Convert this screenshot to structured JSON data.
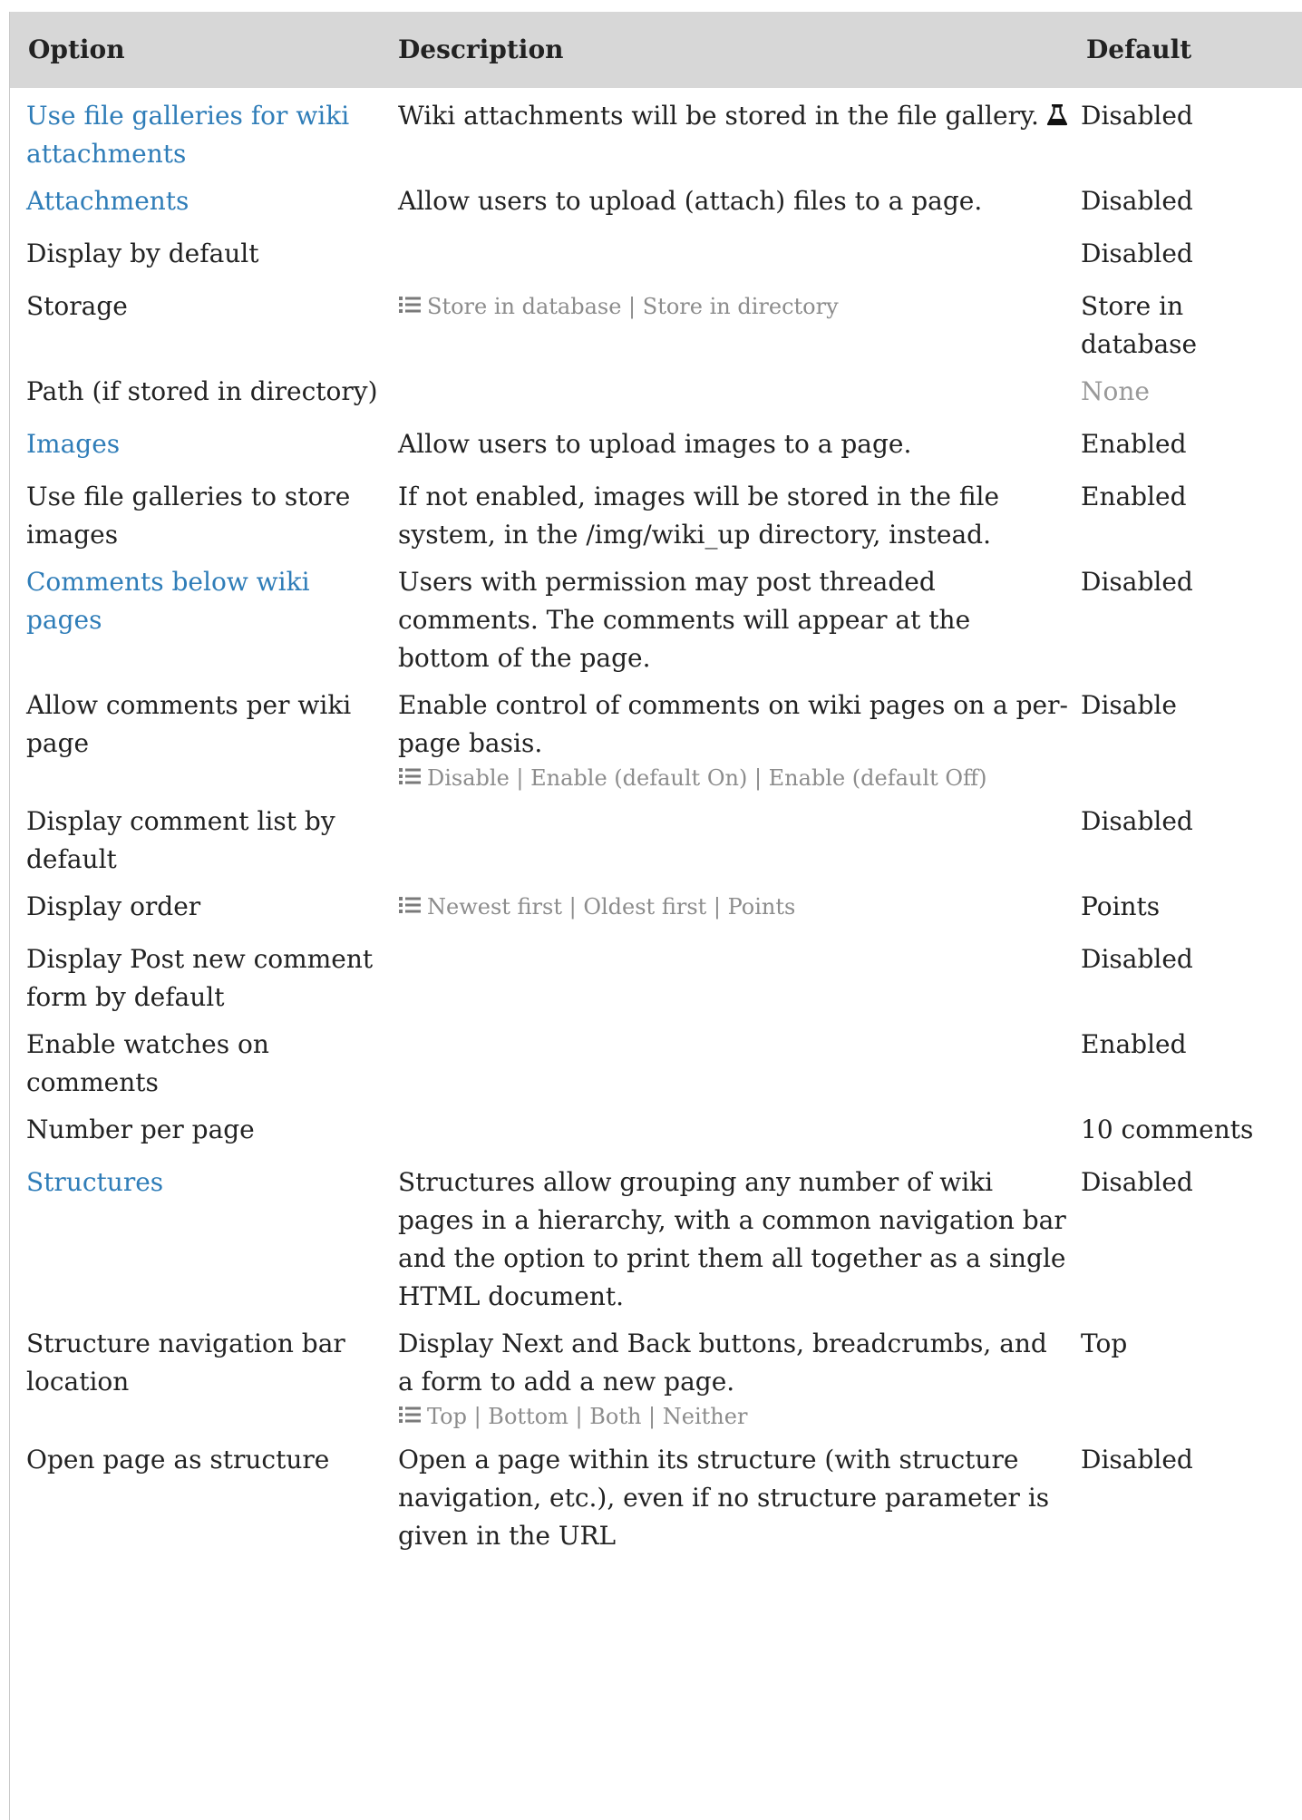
{
  "header": {
    "option": "Option",
    "description": "Description",
    "default": "Default"
  },
  "rows": [
    {
      "option": "Use file galleries for wiki attachments",
      "option_is_link": true,
      "description": "Wiki attachments will be stored in the file gallery.",
      "description_icon": "flask-icon",
      "default": "Disabled"
    },
    {
      "option": "Attachments",
      "option_is_link": true,
      "description": "Allow users to upload (attach) files to a page.",
      "default": "Disabled"
    },
    {
      "option": "Display by default",
      "description": "",
      "default": "Disabled"
    },
    {
      "option": "Storage",
      "description": "",
      "options": "Store in database | Store in directory",
      "options_icon": "list-icon",
      "default": "Store in database"
    },
    {
      "option": "Path (if stored in directory)",
      "description": "",
      "default": "None",
      "default_dim": true
    },
    {
      "option": "Images",
      "option_is_link": true,
      "description": "Allow users to upload images to a page.",
      "default": "Enabled"
    },
    {
      "option": "Use file galleries to store images",
      "description": "If not enabled, images will be stored in the file system, in the /img/wiki_up directory, instead.",
      "default": "Enabled"
    },
    {
      "option": "Comments below wiki pages",
      "option_is_link": true,
      "description": "Users with permission may post threaded comments. The comments will appear at the bottom of the page.",
      "default": "Disabled"
    },
    {
      "option": "Allow comments per wiki page",
      "description": "Enable control of comments on wiki pages on a per-page basis.",
      "options": "Disable | Enable (default On) | Enable (default Off)",
      "options_icon": "list-icon",
      "default": "Disable"
    },
    {
      "option": "Display comment list by default",
      "description": "",
      "default": "Disabled"
    },
    {
      "option": "Display order",
      "description": "",
      "options": "Newest first | Oldest first | Points",
      "options_icon": "list-icon",
      "default": "Points"
    },
    {
      "option": "Display Post new comment form by default",
      "description": "",
      "default": "Disabled"
    },
    {
      "option": "Enable watches on comments",
      "description": "",
      "default": "Enabled"
    },
    {
      "option": "Number per page",
      "description": "",
      "default": "10 comments"
    },
    {
      "option": "Structures",
      "option_is_link": true,
      "description": "Structures allow grouping any number of wiki pages in a hierarchy, with a common navigation bar and the option to print them all together as a single HTML document.",
      "default": "Disabled"
    },
    {
      "option": "Structure navigation bar location",
      "description": "Display Next and Back buttons, breadcrumbs, and a form to add a new page.",
      "options": "Top | Bottom | Both | Neither",
      "options_icon": "list-icon",
      "default": "Top"
    },
    {
      "option": "Open page as structure",
      "description": "Open a page within its structure (with structure navigation, etc.), even if no structure parameter is given in the URL",
      "default": "Disabled"
    }
  ],
  "colors": {
    "link": "#2f7db8",
    "header_bg": "#d7d7d7",
    "muted": "#8c8c8c"
  }
}
